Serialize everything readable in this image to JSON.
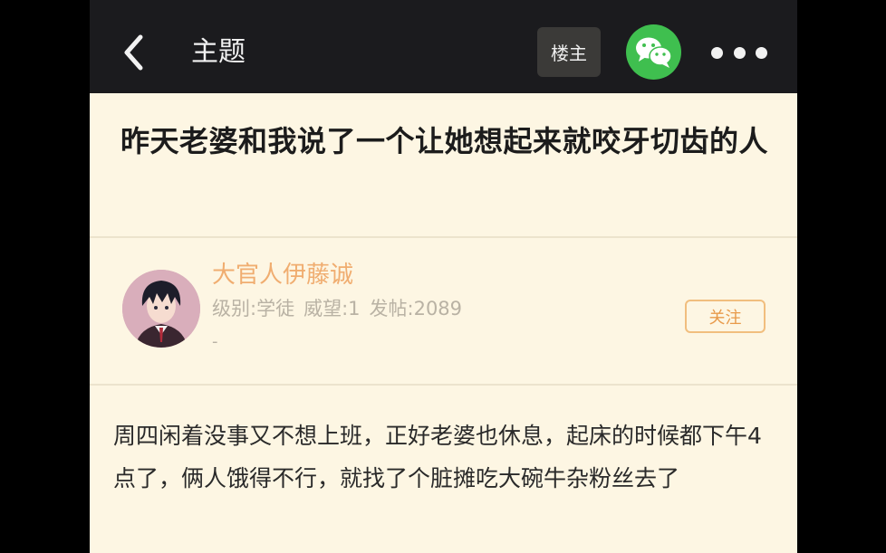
{
  "header": {
    "title": "主题",
    "op_label": "楼主",
    "back_icon": "chevron-left-icon",
    "wechat_icon": "wechat-icon",
    "more_icon": "more-dots-icon",
    "bar_color": "#1b1b1e",
    "wechat_color": "#3fbf4f"
  },
  "post": {
    "title": "昨天老婆和我说了一个让她想起来就咬牙切齿的人",
    "body": "周四闲着没事又不想上班，正好老婆也休息，起床的时候都下午4点了，俩人饿得不行，就找了个脏摊吃大碗牛杂粉丝去了"
  },
  "author": {
    "name": "大官人伊藤诚",
    "level": "级别:学徒",
    "prestige": "威望:1",
    "posts": "发帖:2089",
    "signature": "-",
    "follow_label": "关注",
    "name_color": "#f0ad70"
  },
  "theme": {
    "background": "#fdf6e3",
    "accent": "#e89a4a"
  }
}
